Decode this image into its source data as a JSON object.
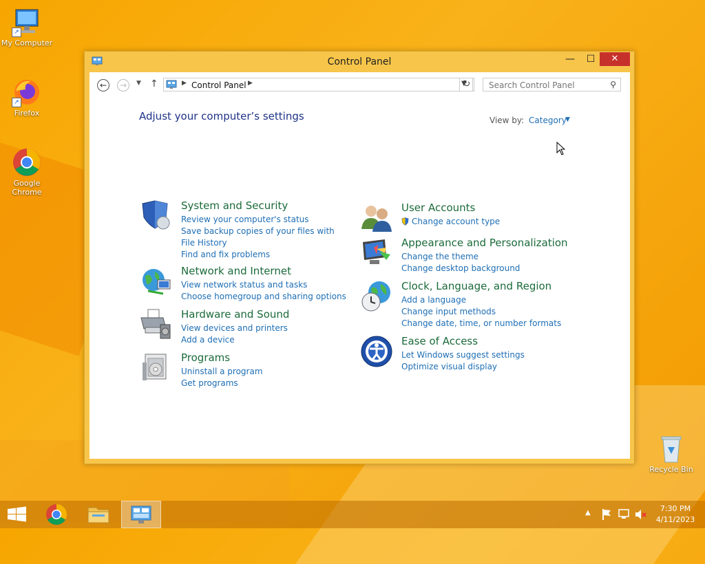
{
  "desktop": {
    "icons": [
      {
        "label": "My Computer",
        "icon": "computer-icon"
      },
      {
        "label": "Firefox",
        "icon": "firefox-icon"
      },
      {
        "label": "Google Chrome",
        "icon": "chrome-icon"
      },
      {
        "label": "Recycle Bin",
        "icon": "recycle-bin-icon"
      }
    ]
  },
  "window": {
    "title": "Control Panel",
    "controls": {
      "minimize": "—",
      "maximize": "☐",
      "close": "✕"
    }
  },
  "nav": {
    "back": "←",
    "forward": "→",
    "up": "↑",
    "breadcrumb": "Control Panel",
    "search_placeholder": "Search Control Panel"
  },
  "main": {
    "heading": "Adjust your computer’s settings",
    "view_by_label": "View by:",
    "view_by_value": "Category",
    "categories": [
      {
        "title": "System and Security",
        "icon": "shield-icon",
        "links": [
          "Review your computer's status",
          "Save backup copies of your files with File History",
          "Find and fix problems"
        ]
      },
      {
        "title": "Network and Internet",
        "icon": "network-globe-icon",
        "links": [
          "View network status and tasks",
          "Choose homegroup and sharing options"
        ]
      },
      {
        "title": "Hardware and Sound",
        "icon": "printer-icon",
        "links": [
          "View devices and printers",
          "Add a device"
        ]
      },
      {
        "title": "Programs",
        "icon": "programs-icon",
        "links": [
          "Uninstall a program",
          "Get programs"
        ]
      },
      {
        "title": "User Accounts",
        "icon": "users-icon",
        "links": [
          "Change account type"
        ]
      },
      {
        "title": "Appearance and Personalization",
        "icon": "monitor-paint-icon",
        "links": [
          "Change the theme",
          "Change desktop background"
        ]
      },
      {
        "title": "Clock, Language, and Region",
        "icon": "clock-globe-icon",
        "links": [
          "Add a language",
          "Change input methods",
          "Change date, time, or number formats"
        ]
      },
      {
        "title": "Ease of Access",
        "icon": "ease-of-access-icon",
        "links": [
          "Let Windows suggest settings",
          "Optimize visual display"
        ]
      }
    ]
  },
  "taskbar": {
    "items": [
      "start-icon",
      "chrome-icon",
      "file-explorer-icon",
      "control-panel-icon"
    ],
    "time": "7:30 PM",
    "date": "4/11/2023"
  }
}
